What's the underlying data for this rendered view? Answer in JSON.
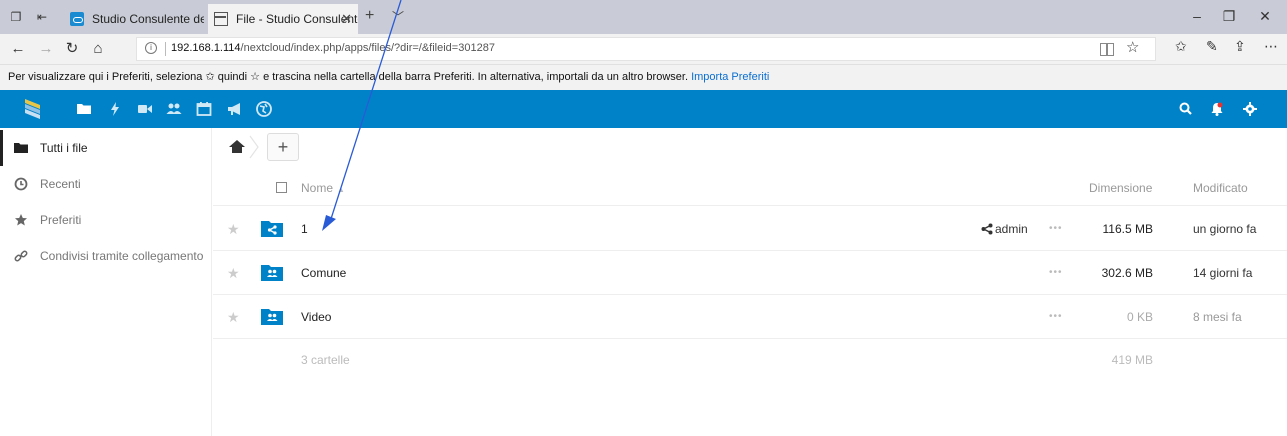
{
  "browser": {
    "tabs": [
      {
        "title": "Studio Consulente del Lavoı",
        "active": false
      },
      {
        "title": "File - Studio Consulente",
        "active": true
      }
    ],
    "new_tab_symbol": "+",
    "tab_close_symbol": "✕",
    "url_prefix": "192.168.1.114",
    "url_rest": "/nextcloud/index.php/apps/files/?dir=/&fileid=301287",
    "favorites_hint": "Per visualizzare qui i Preferiti, seleziona ✩ quindi ☆ e trascina nella cartella della barra Preferiti. In alternativa, importali da un altro browser.",
    "favorites_link": "Importa Preferiti"
  },
  "nextcloud": {
    "accent_color": "#0082c9",
    "header_apps": [
      "files-icon",
      "activity-icon",
      "video-icon",
      "contacts-icon",
      "calendar-icon",
      "announcements-icon",
      "maps-icon"
    ],
    "header_right": [
      "search-icon",
      "notifications-icon",
      "settings-icon"
    ]
  },
  "sidebar": {
    "items": [
      {
        "label": "Tutti i file",
        "icon": "folder-icon",
        "active": true
      },
      {
        "label": "Recenti",
        "icon": "clock-icon",
        "active": false
      },
      {
        "label": "Preferiti",
        "icon": "star-icon",
        "active": false
      },
      {
        "label": "Condivisi tramite collegamento",
        "icon": "link-icon",
        "active": false
      }
    ]
  },
  "files": {
    "add_label": "+",
    "columns": {
      "name": "Nome",
      "sort_indicator": "▲",
      "size": "Dimensione",
      "modified": "Modificato"
    },
    "rows": [
      {
        "name": "1",
        "folder_type": "shared",
        "shared_with": "admin",
        "more": "•••",
        "size": "116.5 MB",
        "modified": "un giorno fa"
      },
      {
        "name": "Comune",
        "folder_type": "group",
        "shared_with": "",
        "more": "•••",
        "size": "302.6 MB",
        "modified": "14 giorni fa"
      },
      {
        "name": "Video",
        "folder_type": "group",
        "shared_with": "",
        "more": "•••",
        "size": "0 KB",
        "modified": "8 mesi fa"
      }
    ],
    "summary": {
      "count": "3 cartelle",
      "total": "419 MB"
    }
  }
}
